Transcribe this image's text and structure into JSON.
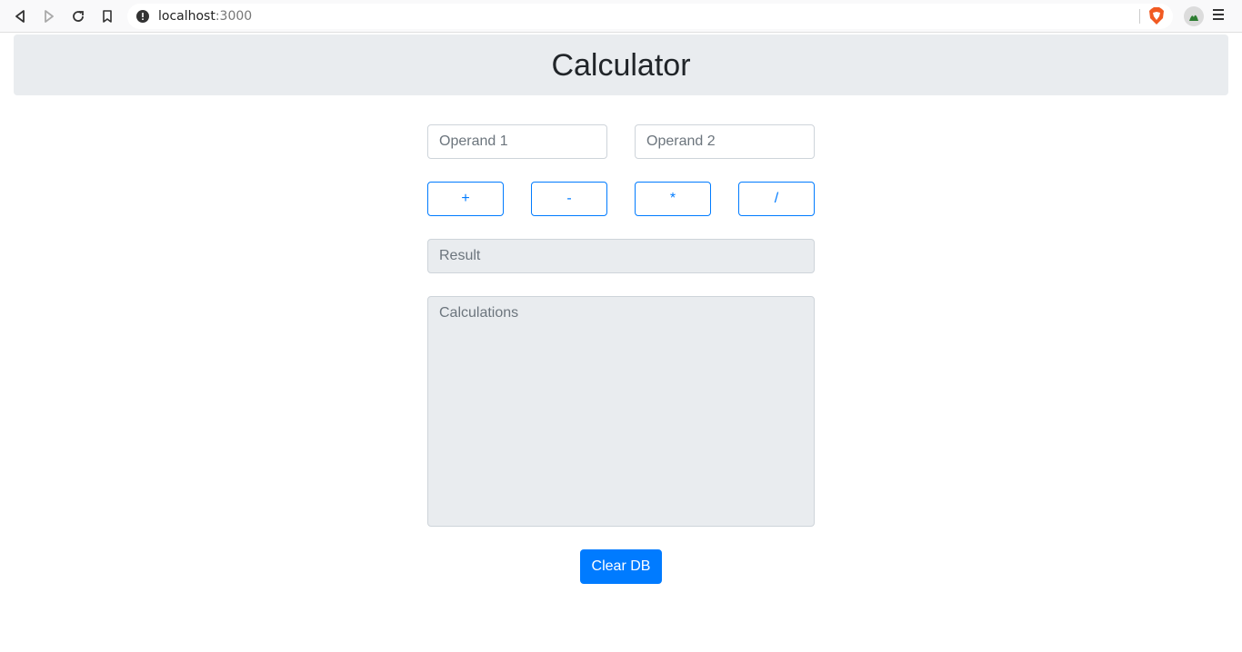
{
  "browser": {
    "url_host": "localhost",
    "url_port": ":3000"
  },
  "header": {
    "title": "Calculator"
  },
  "form": {
    "operand1_placeholder": "Operand 1",
    "operand2_placeholder": "Operand 2",
    "result_placeholder": "Result",
    "calculations_placeholder": "Calculations"
  },
  "operations": {
    "add_label": "+",
    "subtract_label": "-",
    "multiply_label": "*",
    "divide_label": "/"
  },
  "actions": {
    "clear_label": "Clear DB"
  },
  "colors": {
    "primary": "#007bff",
    "header_bg": "#e9ecef",
    "input_border": "#ced4da"
  }
}
